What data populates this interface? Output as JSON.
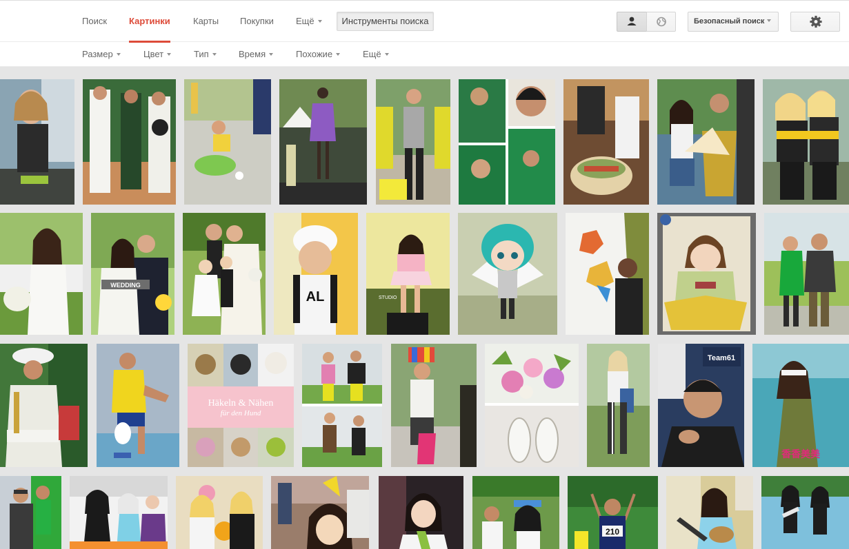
{
  "header": {
    "tabs": [
      {
        "label": "Поиск"
      },
      {
        "label": "Картинки"
      },
      {
        "label": "Карты"
      },
      {
        "label": "Покупки"
      },
      {
        "label": "Ещё"
      }
    ],
    "search_tools_label": "Инструменты поиска",
    "personal_results_icon": "person-icon",
    "hide_personal_icon": "globe-icon",
    "safesearch_label": "Безопасный поиск",
    "settings_icon": "gear-icon"
  },
  "toolsbar": {
    "items": [
      {
        "label": "Размер"
      },
      {
        "label": "Цвет"
      },
      {
        "label": "Тип"
      },
      {
        "label": "Время"
      },
      {
        "label": "Похожие"
      },
      {
        "label": "Ещё"
      }
    ]
  },
  "thumb_text": {
    "wedding": "WEDDING",
    "studio": "STUDIO",
    "al": "AL",
    "book_title": "Häkeln & Nähen",
    "book_subtitle": "für den Hund",
    "team": "Team61",
    "bib": "210"
  },
  "colors": {
    "accent": "#dd4b39",
    "grid_bg": "#e5e5e5"
  }
}
